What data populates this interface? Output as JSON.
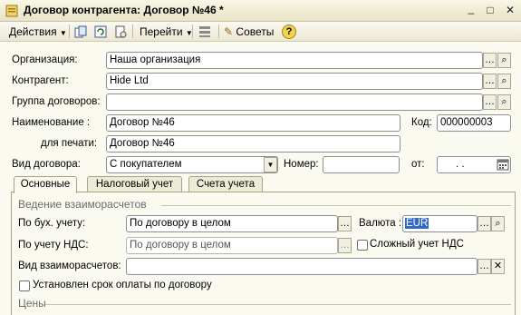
{
  "window": {
    "title": "Договор контрагента: Договор №46 *",
    "minimize": "_",
    "maximize": "□",
    "close": "✕"
  },
  "toolbar": {
    "actions": "Действия",
    "goto": "Перейти",
    "tips": "Советы",
    "help": "?"
  },
  "form": {
    "org_label": "Организация:",
    "org_value": "Наша организация",
    "contractor_label": "Контрагент:",
    "contractor_value": "Hide Ltd",
    "group_label": "Группа договоров:",
    "group_value": "",
    "name_label": "Наименование :",
    "name_value": "Договор №46",
    "code_label": "Код:",
    "code_value": "000000003",
    "print_label": "для печати:",
    "print_value": "Договор №46",
    "type_label": "Вид договора:",
    "type_value": "С покупателем",
    "number_label": "Номер:",
    "number_value": "",
    "from_label": "от:",
    "from_value": ". ."
  },
  "tabs": [
    {
      "label": "Основные",
      "active": true
    },
    {
      "label": "Налоговый учет",
      "active": false
    },
    {
      "label": "Счета учета",
      "active": false
    }
  ],
  "settlements": {
    "section_title": "Ведение взаиморасчетов",
    "acc_label": "По бух. учету:",
    "acc_value": "По договору в целом",
    "currency_label": "Валюта :",
    "currency_value": "EUR",
    "vat_label": "По учету НДС:",
    "vat_value": "По договору в целом",
    "complex_vat_label": "Сложный  учет НДС",
    "complex_vat_checked": false,
    "kind_label": "Вид взаиморасчетов:",
    "kind_value": "",
    "payment_term_label": "Установлен срок оплаты по договору",
    "payment_term_checked": false,
    "prices_title": "Цены"
  },
  "colors": {
    "title_bg": "#ece8cc",
    "toolbar_bg": "#f3f1e2",
    "content_bg": "#fbfaf0",
    "selection": "#316ac5"
  }
}
